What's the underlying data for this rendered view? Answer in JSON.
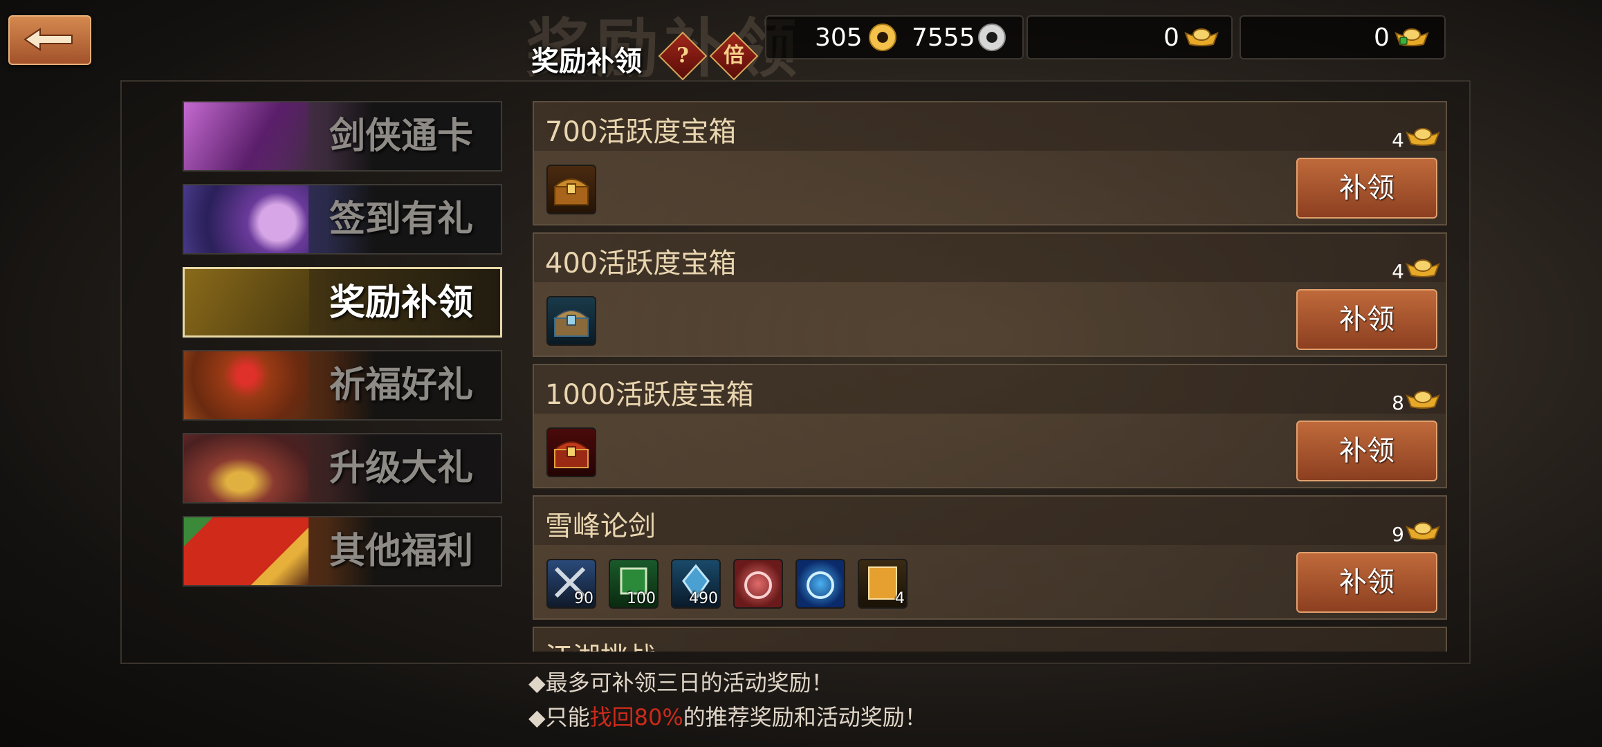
{
  "header": {
    "bg_title": "奖励补领",
    "title": "奖励补领",
    "help_icon": "?",
    "multiplier_icon": "倍"
  },
  "resources": {
    "gold_coins": "305",
    "silver_coins": "7555",
    "ingots": "0",
    "bound_ingots": "0"
  },
  "tabs": [
    {
      "label": "剑侠通卡",
      "active": false
    },
    {
      "label": "签到有礼",
      "active": false
    },
    {
      "label": "奖励补领",
      "active": true
    },
    {
      "label": "祈福好礼",
      "active": false
    },
    {
      "label": "升级大礼",
      "active": false
    },
    {
      "label": "其他福利",
      "active": false
    }
  ],
  "rewards": [
    {
      "title": "700活跃度宝箱",
      "cost": "4",
      "button": "补领",
      "items": [
        {
          "name": "gold-chest-icon",
          "qty": ""
        }
      ]
    },
    {
      "title": "400活跃度宝箱",
      "cost": "4",
      "button": "补领",
      "items": [
        {
          "name": "silver-chest-icon",
          "qty": ""
        }
      ]
    },
    {
      "title": "1000活跃度宝箱",
      "cost": "8",
      "button": "补领",
      "items": [
        {
          "name": "red-chest-icon",
          "qty": ""
        }
      ]
    },
    {
      "title": "雪峰论剑",
      "cost": "9",
      "button": "补领",
      "items": [
        {
          "name": "crossed-swords-icon",
          "qty": "90"
        },
        {
          "name": "jade-token-icon",
          "qty": "100"
        },
        {
          "name": "blue-crystal-icon",
          "qty": "490"
        },
        {
          "name": "red-swirl-orb-icon",
          "qty": ""
        },
        {
          "name": "blue-swirl-orb-icon",
          "qty": ""
        },
        {
          "name": "multiplier-card-icon",
          "qty": "4"
        }
      ]
    },
    {
      "title": "江湖挑战",
      "cost": "",
      "button": "",
      "items": []
    }
  ],
  "notes": {
    "line1": "最多可补领三日的活动奖励！",
    "line2_pre": "只能",
    "line2_hl": "找回80%",
    "line2_post": "的推荐奖励和活动奖励！"
  },
  "colors": {
    "accent": "#c06a3b",
    "highlight": "#cc2a1a"
  }
}
